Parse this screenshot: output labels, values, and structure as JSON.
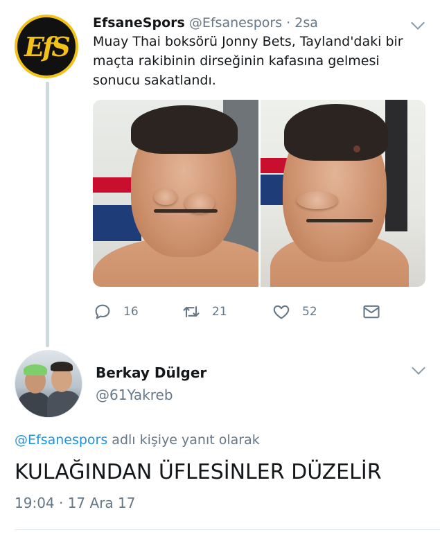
{
  "tweet1": {
    "display_name": "EfsaneSpors",
    "handle": "@Efsanespors",
    "separator": "·",
    "time": "2sa",
    "avatar_text": "EfS",
    "text": "Muay Thai boksörü Jonny Bets, Tayland'daki bir maçta rakibinin dirseğinin kafasına gelmesi sonucu sakatlandı.",
    "actions": {
      "reply": {
        "icon": "reply-icon",
        "count": "16"
      },
      "retweet": {
        "icon": "retweet-icon",
        "count": "21"
      },
      "like": {
        "icon": "heart-icon",
        "count": "52"
      },
      "message": {
        "icon": "envelope-icon"
      }
    }
  },
  "tweet2": {
    "display_name": "Berkay Dülger",
    "handle": "@61Yakreb",
    "reply_mention": "@Efsanespors",
    "reply_suffix": " adlı kişiye yanıt olarak",
    "text": "KULAĞINDAN ÜFLESİNLER DÜZELİR",
    "timestamp": "19:04 · 17 Ara 17"
  },
  "colors": {
    "primary_text": "#14171a",
    "secondary_text": "#657786",
    "link": "#1b95e0",
    "thread_line": "#cfd9de",
    "avatar_gold": "#f2c21a"
  }
}
